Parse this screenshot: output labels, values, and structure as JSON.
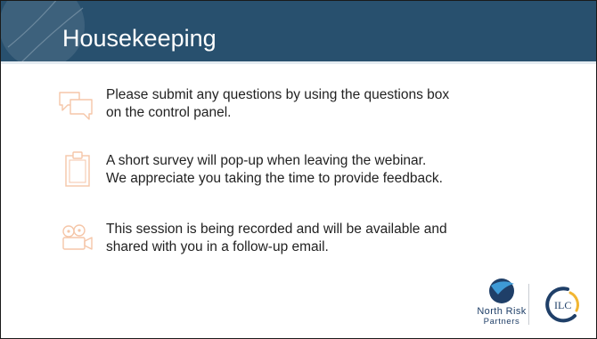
{
  "slide": {
    "title": "Housekeeping",
    "colors": {
      "header_bg": "#28506e",
      "accent_icon": "#f5c6a8",
      "body_text": "#222222",
      "logo_navy": "#1f3f68",
      "logo_gold": "#f2b632"
    }
  },
  "items": [
    {
      "icon": "chat-bubbles-icon",
      "lines": [
        "Please submit any questions by using the questions box",
        "on the control panel."
      ]
    },
    {
      "icon": "clipboard-icon",
      "lines": [
        "A short survey will pop-up when leaving the webinar.",
        "We appreciate you taking the time to provide feedback."
      ]
    },
    {
      "icon": "video-camera-icon",
      "lines": [
        "This session is being recorded and will be available and",
        "shared with you in a follow-up email."
      ]
    }
  ],
  "logos": {
    "north_risk_partners": {
      "line1": "North Risk",
      "line2": "Partners"
    },
    "ilc": {
      "text": "ILC"
    }
  }
}
